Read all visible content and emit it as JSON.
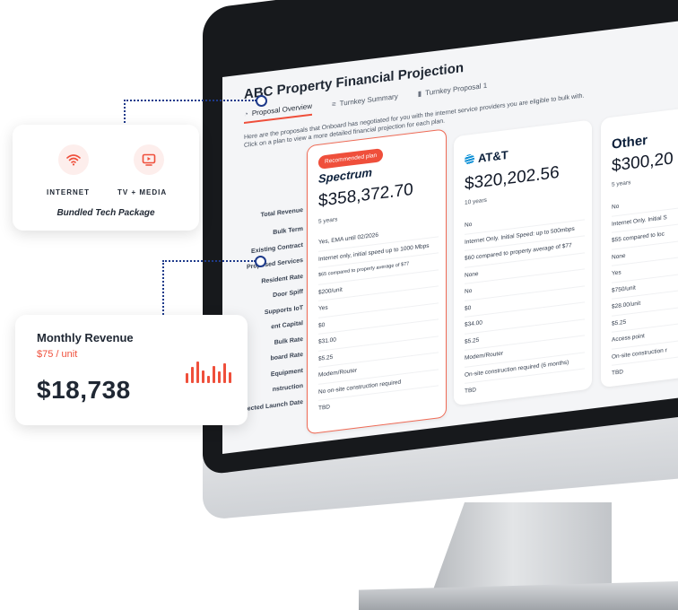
{
  "projection": {
    "title": "ABC Property Financial Projection",
    "tabs": [
      {
        "label": "Proposal Overview",
        "active": true,
        "icon": "gauge-icon"
      },
      {
        "label": "Turnkey Summary",
        "active": false,
        "icon": "list-icon"
      },
      {
        "label": "Turnkey Proposal 1",
        "active": false,
        "icon": "document-icon"
      }
    ],
    "intro_line1": "Here are the proposals that Onboard has negotiated for you with the internet service providers you are eligible to bulk with.",
    "intro_line2": "Click on a plan to view a more detailed financial projection for each plan.",
    "row_labels": [
      "Total Revenue",
      "Bulk Term",
      "Existing Contract",
      "Proposed Services",
      "Resident Rate",
      "Door Spiff",
      "Supports IoT",
      "ent Capital",
      "Bulk Rate",
      "board Rate",
      "Equipment",
      "nstruction",
      "Projected Launch Date"
    ],
    "plans": [
      {
        "badge": "Recommended plan",
        "name": "Spectrum",
        "price": "$358,372.70",
        "term": "5 years",
        "values": [
          "Yes, EMA until 02/2026",
          "Internet only, initial speed up to 1000 Mbps",
          "$65 compared to property average of $77",
          "$200/unit",
          "Yes",
          "$0",
          "$31.00",
          "$5.25",
          "Modem/Router",
          "No on-site construction required",
          "TBD"
        ]
      },
      {
        "badge": "",
        "name": "AT&T",
        "price": "$320,202.56",
        "term": "10 years",
        "values": [
          "No",
          "Internet Only. Initial Speed: up to 500mbps",
          "$60 compared to property average of $77",
          "None",
          "No",
          "$0",
          "$34.00",
          "$5.25",
          "Modem/Router",
          "On-site construction required (6 months)",
          "TBD"
        ]
      },
      {
        "badge": "",
        "name": "Other",
        "price": "$300,20",
        "term": "5 years",
        "values": [
          "No",
          "Internet Only. Initial S",
          "$55 compared to loc",
          "None",
          "Yes",
          "$750/unit",
          "$28.00/unit",
          "$5.25",
          "Access point",
          "On-site construction r",
          "TBD"
        ]
      }
    ]
  },
  "tech_card": {
    "items": [
      {
        "label": "INTERNET",
        "icon": "wifi-icon"
      },
      {
        "label": "TV + MEDIA",
        "icon": "tv-icon"
      }
    ],
    "title": "Bundled Tech Package"
  },
  "revenue_card": {
    "title": "Monthly Revenue",
    "subtitle": "$75 / unit",
    "amount": "$18,738",
    "icon": "bar-chart-icon",
    "bar_levels": [
      0.45,
      0.75,
      1.0,
      0.6,
      0.35,
      0.8,
      0.55,
      0.9,
      0.5
    ]
  },
  "colors": {
    "accent": "#ef4f3b",
    "navy": "#1e3a8a",
    "text": "#1f2733"
  }
}
